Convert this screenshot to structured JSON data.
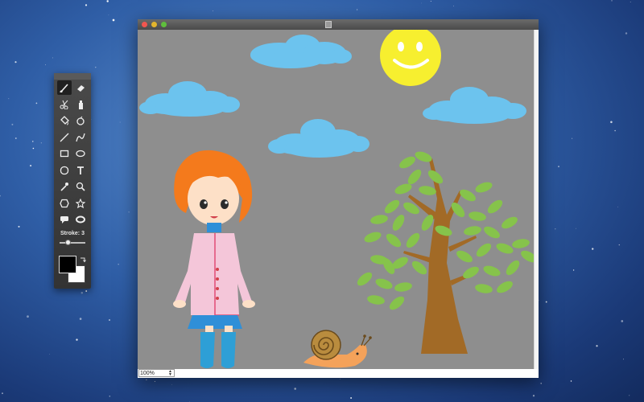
{
  "tools": [
    {
      "icon": "brush-icon",
      "active": true
    },
    {
      "icon": "eraser-icon",
      "active": false
    },
    {
      "icon": "scissors-icon",
      "active": false
    },
    {
      "icon": "spray-can-icon",
      "active": false
    },
    {
      "icon": "paint-bucket-icon",
      "active": false
    },
    {
      "icon": "spray-tool-icon",
      "active": false
    },
    {
      "icon": "line-icon",
      "active": false
    },
    {
      "icon": "curve-icon",
      "active": false
    },
    {
      "icon": "rectangle-icon",
      "active": false
    },
    {
      "icon": "ellipse-icon",
      "active": false
    },
    {
      "icon": "rounded-rectangle-icon",
      "active": false
    },
    {
      "icon": "text-icon",
      "active": false
    },
    {
      "icon": "eyedropper-icon",
      "active": false
    },
    {
      "icon": "zoom-icon",
      "active": false
    },
    {
      "icon": "hexagon-icon",
      "active": false
    },
    {
      "icon": "star-icon",
      "active": false
    },
    {
      "icon": "speech-bubble-icon",
      "active": false
    },
    {
      "icon": "oval-icon",
      "active": false
    }
  ],
  "stroke": {
    "label": "Stroke: 3",
    "value": 3,
    "level": 0.3
  },
  "colors": {
    "foreground": "#000000",
    "background": "#ffffff"
  },
  "zoom": {
    "value": "100%"
  },
  "canvas": {
    "background": "#8e8e8e"
  },
  "drawing": {
    "sky_color": "#6cc3ee",
    "sun_color": "#f7ef2f",
    "hair_color": "#f47a1c",
    "coat_color": "#f4c6d9",
    "skirt_color": "#2f8fd8",
    "boot_color": "#2e9fd6",
    "leaf_color": "#86c34b",
    "trunk_color": "#a26a26",
    "snail_shell_color": "#b98c3e",
    "snail_body_color": "#f4a25a"
  }
}
